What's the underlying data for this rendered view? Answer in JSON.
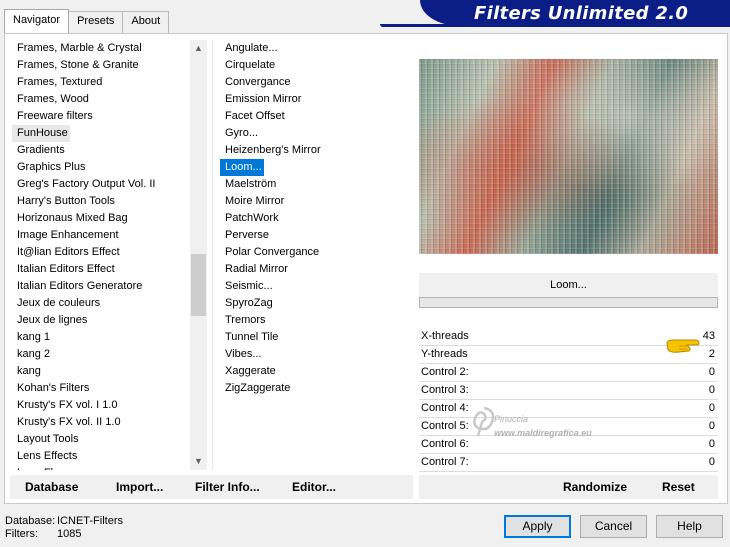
{
  "tabs": [
    {
      "label": "Navigator",
      "active": true
    },
    {
      "label": "Presets",
      "active": false
    },
    {
      "label": "About",
      "active": false
    }
  ],
  "banner": {
    "title": "Filters Unlimited 2.0"
  },
  "categories": [
    "Frames, Marble & Crystal",
    "Frames, Stone & Granite",
    "Frames, Textured",
    "Frames, Wood",
    "Freeware filters",
    "FunHouse",
    "Gradients",
    "Graphics Plus",
    "Greg's Factory Output Vol. II",
    "Harry's Button Tools",
    "Horizonaus Mixed Bag",
    "Image Enhancement",
    "It@lian Editors Effect",
    "Italian Editors Effect",
    "Italian Editors Generatore",
    "Jeux de couleurs",
    "Jeux de lignes",
    "kang 1",
    "kang 2",
    "kang",
    "Kohan's Filters",
    "Krusty's FX vol. I 1.0",
    "Krusty's FX vol. II 1.0",
    "Layout Tools",
    "Lens Effects",
    "Lens Flare"
  ],
  "selected_category": "FunHouse",
  "filters": [
    "Angulate...",
    "Cirquelate",
    "Convergance",
    "Emission Mirror",
    "Facet Offset",
    "Gyro...",
    "Heizenberg's Mirror",
    "Loom...",
    "Maelström",
    "Moire Mirror",
    "PatchWork",
    "Perverse",
    "Polar Convergance",
    "Radial Mirror",
    "Seismic...",
    "SpyroZag",
    "Tremors",
    "Tunnel Tile",
    "Vibes...",
    "Xaggerate",
    "ZigZaggerate"
  ],
  "selected_filter": "Loom...",
  "filter_name_display": "Loom...",
  "controls": [
    {
      "label": "X-threads",
      "value": "43"
    },
    {
      "label": "Y-threads",
      "value": "2"
    },
    {
      "label": "Control 2:",
      "value": "0"
    },
    {
      "label": "Control 3:",
      "value": "0"
    },
    {
      "label": "Control 4:",
      "value": "0"
    },
    {
      "label": "Control 5:",
      "value": "0"
    },
    {
      "label": "Control 6:",
      "value": "0"
    },
    {
      "label": "Control 7:",
      "value": "0"
    }
  ],
  "watermark": {
    "line1": "Pinuccia",
    "line2": "www.maldiregrafica.eu"
  },
  "toolbar_left": {
    "database": "Database",
    "import": "Import...",
    "filter_info": "Filter Info...",
    "editor": "Editor..."
  },
  "toolbar_right": {
    "randomize": "Randomize",
    "reset": "Reset"
  },
  "status": {
    "database_label": "Database:",
    "database_value": "ICNET-Filters",
    "filters_label": "Filters:",
    "filters_value": "1085"
  },
  "buttons": {
    "apply": "Apply",
    "cancel": "Cancel",
    "help": "Help"
  },
  "colors": {
    "banner": "#0b1d86",
    "selection": "#0078d7",
    "pointer": "#f5c400"
  },
  "icons": {
    "scroll_up": "chevron-up-icon",
    "scroll_down": "chevron-down-icon",
    "pointer": "pointing-hand-icon"
  }
}
